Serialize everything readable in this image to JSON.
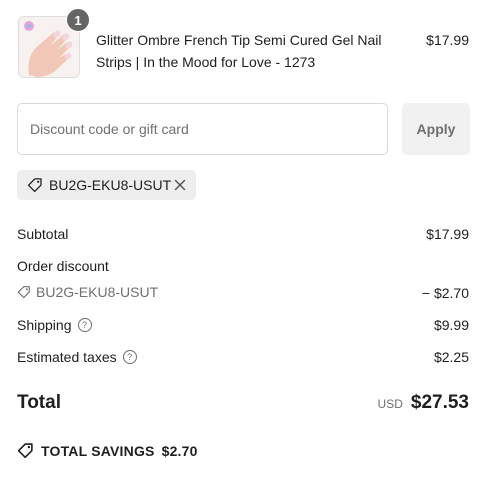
{
  "product": {
    "quantity": "1",
    "title": "Glitter Ombre French Tip Semi Cured Gel Nail Strips | In the Mood for Love - 1273",
    "price": "$17.99"
  },
  "discount": {
    "placeholder": "Discount code or gift card",
    "apply_label": "Apply",
    "applied_code": "BU2G-EKU8-USUT"
  },
  "summary": {
    "subtotal_label": "Subtotal",
    "subtotal_value": "$17.99",
    "order_discount_label": "Order discount",
    "discount_code": "BU2G-EKU8-USUT",
    "discount_value": "− $2.70",
    "shipping_label": "Shipping",
    "shipping_value": "$9.99",
    "taxes_label": "Estimated taxes",
    "taxes_value": "$2.25",
    "total_label": "Total",
    "currency": "USD",
    "total_value": "$27.53",
    "savings_label": "TOTAL SAVINGS",
    "savings_value": "$2.70"
  },
  "colors": {
    "text": "#1f1f1f",
    "muted": "#707070",
    "chip_bg": "#eeeeee",
    "badge_bg": "#666666"
  }
}
